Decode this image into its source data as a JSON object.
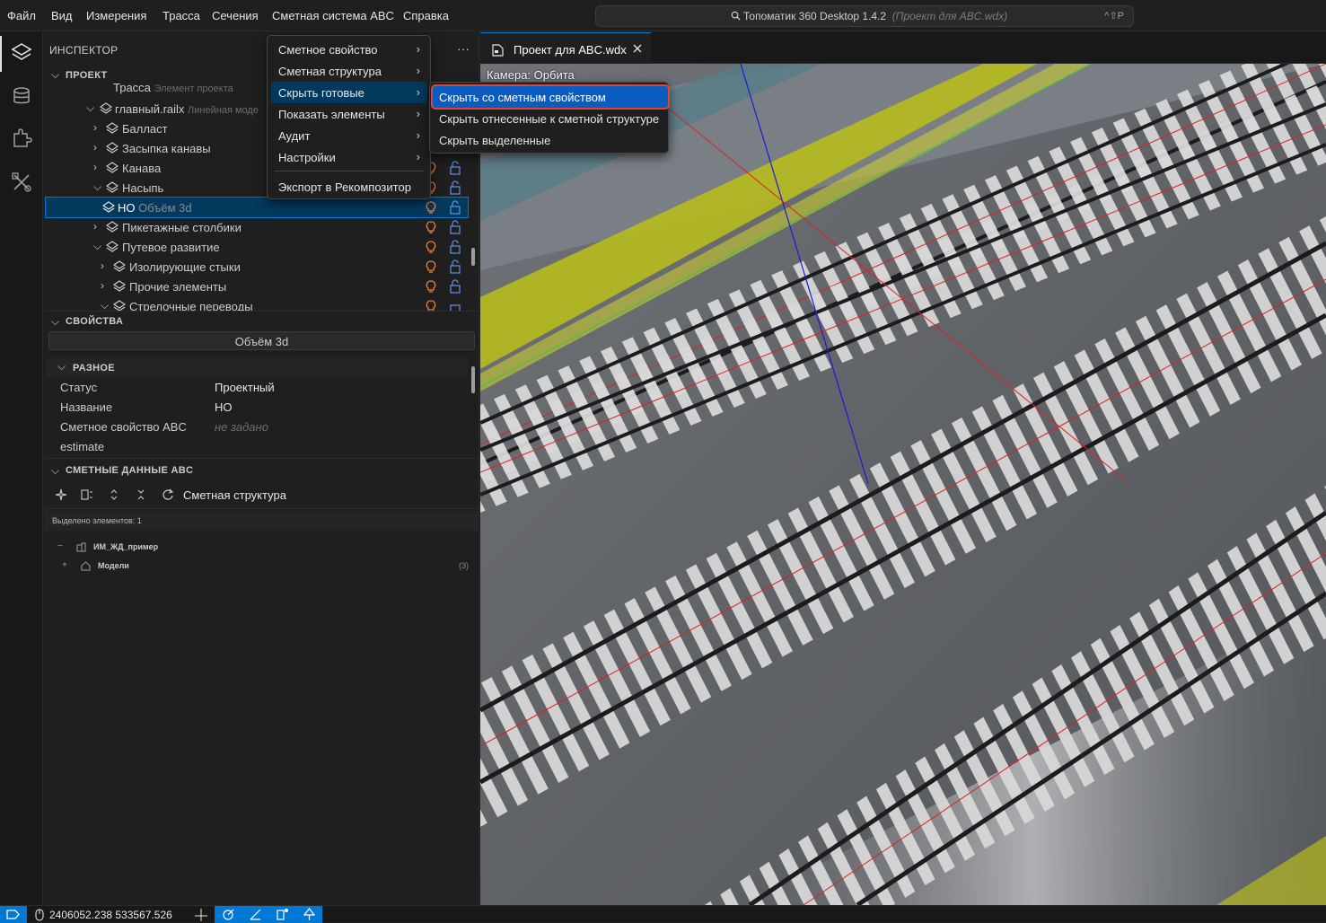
{
  "menubar": {
    "items": [
      "Файл",
      "Вид",
      "Измерения",
      "Трасса",
      "Сечения",
      "Сметная система ABC",
      "Справка"
    ],
    "command_center": {
      "title": "Топоматик 360 Desktop 1.4.2",
      "project": "(Проект для ABC.wdx)",
      "shortcut": "^⇧P"
    }
  },
  "inspector": {
    "title": "ИНСПЕКТОР",
    "more": "···",
    "project_header": "ПРОЕКТ",
    "tree": [
      {
        "label": "Трасса",
        "hint": "Элемент проекта"
      },
      {
        "label": "главный.railx",
        "hint": "Линейная моде"
      },
      {
        "label": "Балласт"
      },
      {
        "label": "Засыпка канавы"
      },
      {
        "label": "Канава"
      },
      {
        "label": "Насыпь"
      },
      {
        "label": "НО",
        "hint": "Объём 3d"
      },
      {
        "label": "Пикетажные столбики"
      },
      {
        "label": "Путевое развитие"
      },
      {
        "label": "Изолирующие стыки"
      },
      {
        "label": "Прочие элементы"
      },
      {
        "label": "Стрелочные переводы"
      }
    ]
  },
  "properties": {
    "header": "СВОЙСТВА",
    "object_type": "Объём 3d",
    "group": "РАЗНОЕ",
    "rows": [
      {
        "key": "Статус",
        "value": "Проектный"
      },
      {
        "key": "Название",
        "value": "НО"
      },
      {
        "key": "Сметное свойство ABC",
        "value": "не задано"
      },
      {
        "key": "estimate",
        "value": ""
      }
    ]
  },
  "estimate_data": {
    "header": "СМЕТНЫЕ ДАННЫЕ ABC",
    "toolbar_label": "Сметная структура",
    "selected": "Выделено элементов: 1",
    "tree": [
      {
        "sign": "−",
        "label": "ИМ_ЖД_пример",
        "count": ""
      },
      {
        "sign": "+",
        "label": "Модели",
        "count": "(3)"
      }
    ]
  },
  "editor": {
    "tab_label": "Проект для ABC.wdx",
    "camera": "Камера: Орбита"
  },
  "context_menu": {
    "items": [
      {
        "label": "Сметное свойство",
        "submenu": true
      },
      {
        "label": "Сметная структура",
        "submenu": true
      },
      {
        "label": "Скрыть готовые",
        "submenu": true
      },
      {
        "label": "Показать элементы",
        "submenu": true
      },
      {
        "label": "Аудит",
        "submenu": true
      },
      {
        "label": "Настройки",
        "submenu": true
      },
      {
        "label": "Экспорт в Рекомпозитор",
        "submenu": false
      }
    ],
    "submenu": [
      "Скрыть со сметным свойством",
      "Скрыть отнесенные к сметной структуре",
      "Скрыть выделенные"
    ]
  },
  "statusbar": {
    "coords": "2406052.238 533567.526"
  },
  "colors": {
    "accent": "#0078d4",
    "highlight_border": "#e0453a",
    "bulb": "#e8823a",
    "lock": "#5b8bd9"
  }
}
